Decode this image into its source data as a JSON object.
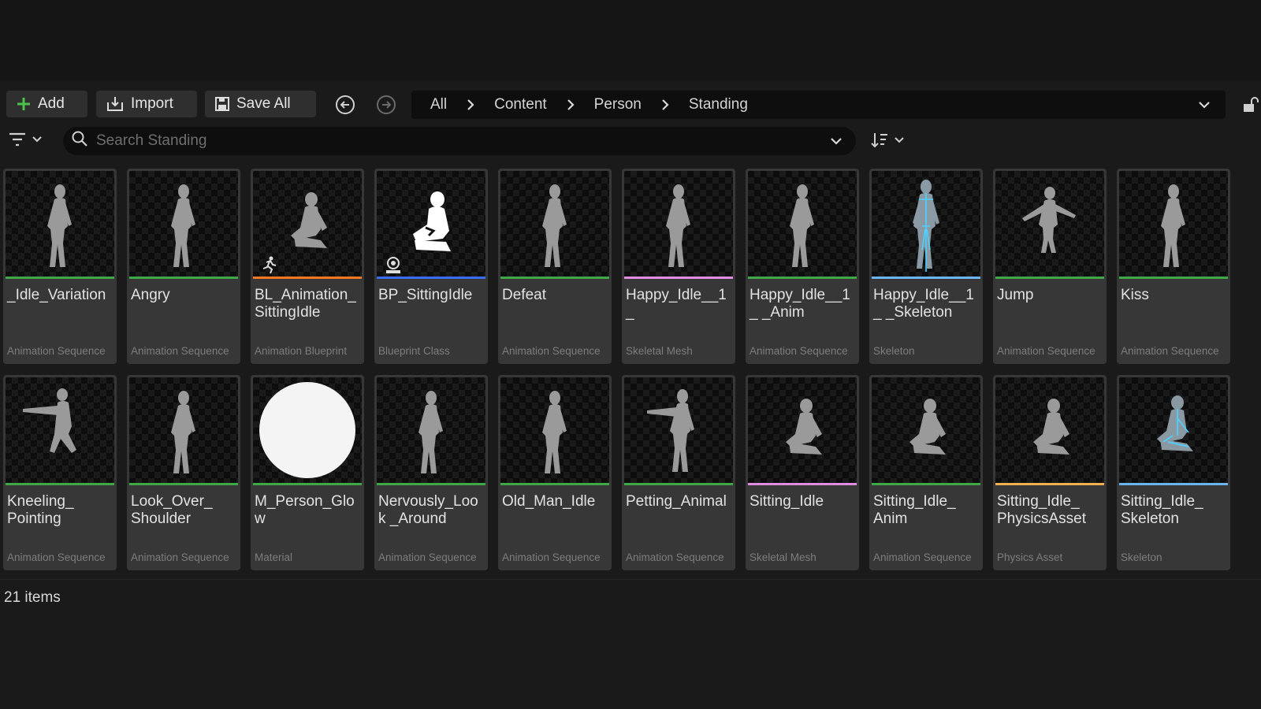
{
  "toolbar": {
    "add_label": "Add",
    "import_label": "Import",
    "save_all_label": "Save All"
  },
  "breadcrumb": [
    "All",
    "Content",
    "Person",
    "Standing"
  ],
  "search": {
    "placeholder": "Search Standing"
  },
  "colors": {
    "animation_sequence": "#3da845",
    "skeletal_mesh": "#e08ce0",
    "skeleton": "#6cb4f0",
    "blueprint_class": "#3a6cf0",
    "animation_blueprint": "#f07820",
    "physics_asset": "#f0b050",
    "material": "#3da845"
  },
  "assets": [
    {
      "name": "_Idle_Variation",
      "type": "Animation Sequence",
      "color": "animation_sequence",
      "thumb": "figure-standing"
    },
    {
      "name": "Angry",
      "type": "Animation Sequence",
      "color": "animation_sequence",
      "thumb": "figure-standing"
    },
    {
      "name": "BL_Animation_ SittingIdle",
      "type": "Animation Blueprint",
      "color": "animation_blueprint",
      "thumb": "figure-sitting",
      "badge": "running-person-icon"
    },
    {
      "name": "BP_SittingIdle",
      "type": "Blueprint Class",
      "color": "blueprint_class",
      "thumb": "white-sitting",
      "badge": "camera-icon"
    },
    {
      "name": "Defeat",
      "type": "Animation Sequence",
      "color": "animation_sequence",
      "thumb": "figure-standing"
    },
    {
      "name": "Happy_Idle__1_",
      "type": "Skeletal Mesh",
      "color": "skeletal_mesh",
      "thumb": "figure-standing"
    },
    {
      "name": "Happy_Idle__1_ _Anim",
      "type": "Animation Sequence",
      "color": "animation_sequence",
      "thumb": "figure-standing"
    },
    {
      "name": "Happy_Idle__1_ _Skeleton",
      "type": "Skeleton",
      "color": "skeleton",
      "thumb": "figure-skeleton"
    },
    {
      "name": "Jump",
      "type": "Animation Sequence",
      "color": "animation_sequence",
      "thumb": "figure-jump"
    },
    {
      "name": "Kiss",
      "type": "Animation Sequence",
      "color": "animation_sequence",
      "thumb": "figure-standing"
    },
    {
      "name": "Kneeling_ Pointing",
      "type": "Animation Sequence",
      "color": "animation_sequence",
      "thumb": "figure-kneeling"
    },
    {
      "name": "Look_Over_ Shoulder",
      "type": "Animation Sequence",
      "color": "animation_sequence",
      "thumb": "figure-standing"
    },
    {
      "name": "M_Person_Glow",
      "type": "Material",
      "color": "material",
      "thumb": "sphere"
    },
    {
      "name": "Nervously_Look _Around",
      "type": "Animation Sequence",
      "color": "animation_sequence",
      "thumb": "figure-standing"
    },
    {
      "name": "Old_Man_Idle",
      "type": "Animation Sequence",
      "color": "animation_sequence",
      "thumb": "figure-standing"
    },
    {
      "name": "Petting_Animal",
      "type": "Animation Sequence",
      "color": "animation_sequence",
      "thumb": "figure-pointing"
    },
    {
      "name": "Sitting_Idle",
      "type": "Skeletal Mesh",
      "color": "skeletal_mesh",
      "thumb": "figure-sitting"
    },
    {
      "name": "Sitting_Idle_ Anim",
      "type": "Animation Sequence",
      "color": "animation_sequence",
      "thumb": "figure-sitting"
    },
    {
      "name": "Sitting_Idle_ PhysicsAsset",
      "type": "Physics Asset",
      "color": "physics_asset",
      "thumb": "figure-sitting"
    },
    {
      "name": "Sitting_Idle_ Skeleton",
      "type": "Skeleton",
      "color": "skeleton",
      "thumb": "figure-sitting-skeleton"
    }
  ],
  "footer": {
    "item_count": "21 items"
  }
}
